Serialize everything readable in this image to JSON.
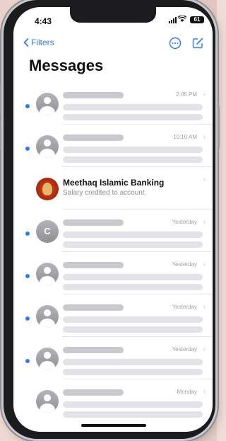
{
  "status_bar": {
    "time": "4:43",
    "battery": "61"
  },
  "nav": {
    "back_label": "Filters"
  },
  "page": {
    "title": "Messages"
  },
  "conversations": [
    {
      "kind": "placeholder",
      "time": "2:06 PM",
      "unread": true,
      "avatar": "person"
    },
    {
      "kind": "placeholder",
      "time": "10:10 AM",
      "unread": true,
      "avatar": "person"
    },
    {
      "kind": "named",
      "name": "Meethaq Islamic Banking",
      "preview": "Salary credited to account",
      "time": "",
      "unread": false,
      "avatar": "bank-logo"
    },
    {
      "kind": "placeholder",
      "time": "Yesterday",
      "unread": true,
      "avatar": "letter",
      "letter": "C"
    },
    {
      "kind": "placeholder",
      "time": "Yesterday",
      "unread": true,
      "avatar": "person"
    },
    {
      "kind": "placeholder",
      "time": "Yesterday",
      "unread": true,
      "avatar": "person"
    },
    {
      "kind": "placeholder",
      "time": "Yesterday",
      "unread": true,
      "avatar": "person"
    },
    {
      "kind": "placeholder",
      "time": "Monday",
      "unread": false,
      "avatar": "person"
    }
  ],
  "colors": {
    "accent": "#2f7bf5",
    "unread_dot": "#2f7bf5",
    "bank_logo": "#b3300f"
  }
}
